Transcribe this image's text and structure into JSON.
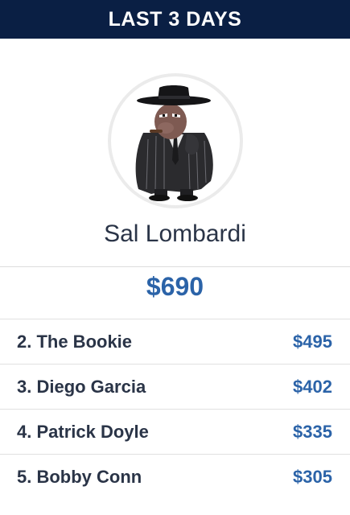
{
  "header": {
    "title": "LAST 3 DAYS",
    "background_color": "#0a1f44"
  },
  "leader": {
    "avatar_icon": "gangster-avatar-icon",
    "name": "Sal Lombardi",
    "amount": "$690"
  },
  "colors": {
    "name_text": "#2a3447",
    "amount_text": "#2b63a8"
  },
  "leaderboard": [
    {
      "label": "2. The Bookie",
      "amount": "$495"
    },
    {
      "label": "3. Diego Garcia",
      "amount": "$402"
    },
    {
      "label": "4. Patrick Doyle",
      "amount": "$335"
    },
    {
      "label": "5. Bobby Conn",
      "amount": "$305"
    }
  ]
}
